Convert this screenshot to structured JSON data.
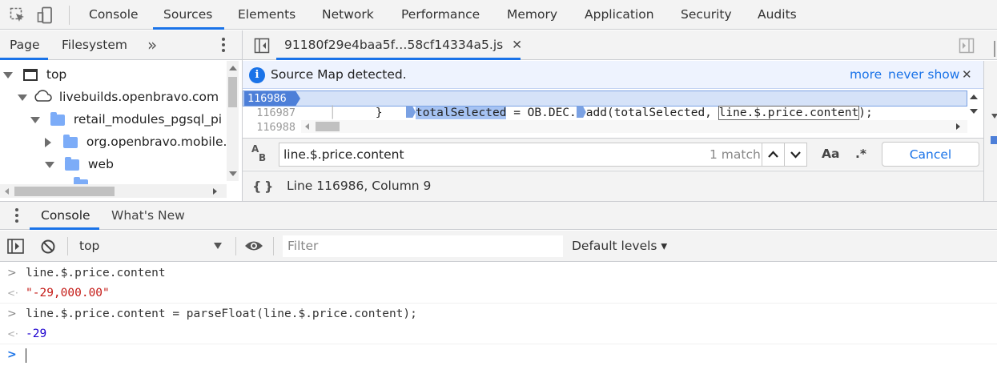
{
  "toolbar": {
    "tabs": [
      "Console",
      "Sources",
      "Elements",
      "Network",
      "Performance",
      "Memory",
      "Application",
      "Security",
      "Audits"
    ],
    "active_tab": "Sources"
  },
  "navigator": {
    "tabs": [
      "Page",
      "Filesystem"
    ],
    "more_glyph": "»",
    "tree": [
      {
        "label": "top",
        "icon": "frame-icon",
        "expanded": true
      },
      {
        "label": "livebuilds.openbravo.com",
        "icon": "cloud-icon",
        "expanded": true
      },
      {
        "label": "retail_modules_pgsql_pi",
        "icon": "folder-icon",
        "expanded": true
      },
      {
        "label": "org.openbravo.mobile.c",
        "icon": "folder-icon",
        "expanded": false
      },
      {
        "label": "web",
        "icon": "folder-icon",
        "expanded": true
      }
    ]
  },
  "editor": {
    "file_tab": "91180f29e4baa5f…58cf14334a5.js",
    "infobar": {
      "message": "Source Map detected.",
      "more": "more",
      "never_show": "never show"
    },
    "lines": [
      {
        "number": "116986",
        "code_a": "totalSelected",
        "code_b": " = OB.DEC.",
        "code_c": "add(totalSelected, ",
        "code_d": "line.$.price.content",
        "code_e": ");"
      },
      {
        "number": "116987",
        "code": "        }"
      },
      {
        "number": "116988",
        "code": ""
      }
    ],
    "search": {
      "query": "line.$.price.content",
      "match_count": "1 match",
      "case_label": "Aa",
      "regex_label": ".*",
      "cancel": "Cancel"
    },
    "status": {
      "pretty_print": "{ }",
      "position": "Line 116986, Column 9"
    }
  },
  "drawer": {
    "tabs": [
      "Console",
      "What's New"
    ],
    "context": "top",
    "filter_placeholder": "Filter",
    "levels": "Default levels ▾"
  },
  "console": {
    "messages": [
      {
        "type": "input",
        "text": "line.$.price.content"
      },
      {
        "type": "output-string",
        "text": "\"-29,000.00\""
      },
      {
        "type": "input",
        "text": "line.$.price.content = parseFloat(line.$.price.content);"
      },
      {
        "type": "output-number",
        "text": "-29"
      }
    ]
  },
  "colors": {
    "accent": "#1a73e8",
    "toolbar_bg": "#f3f3f3",
    "string": "#c41a16",
    "number": "#1c00cf",
    "highlight_line": "#d5e2f8"
  }
}
